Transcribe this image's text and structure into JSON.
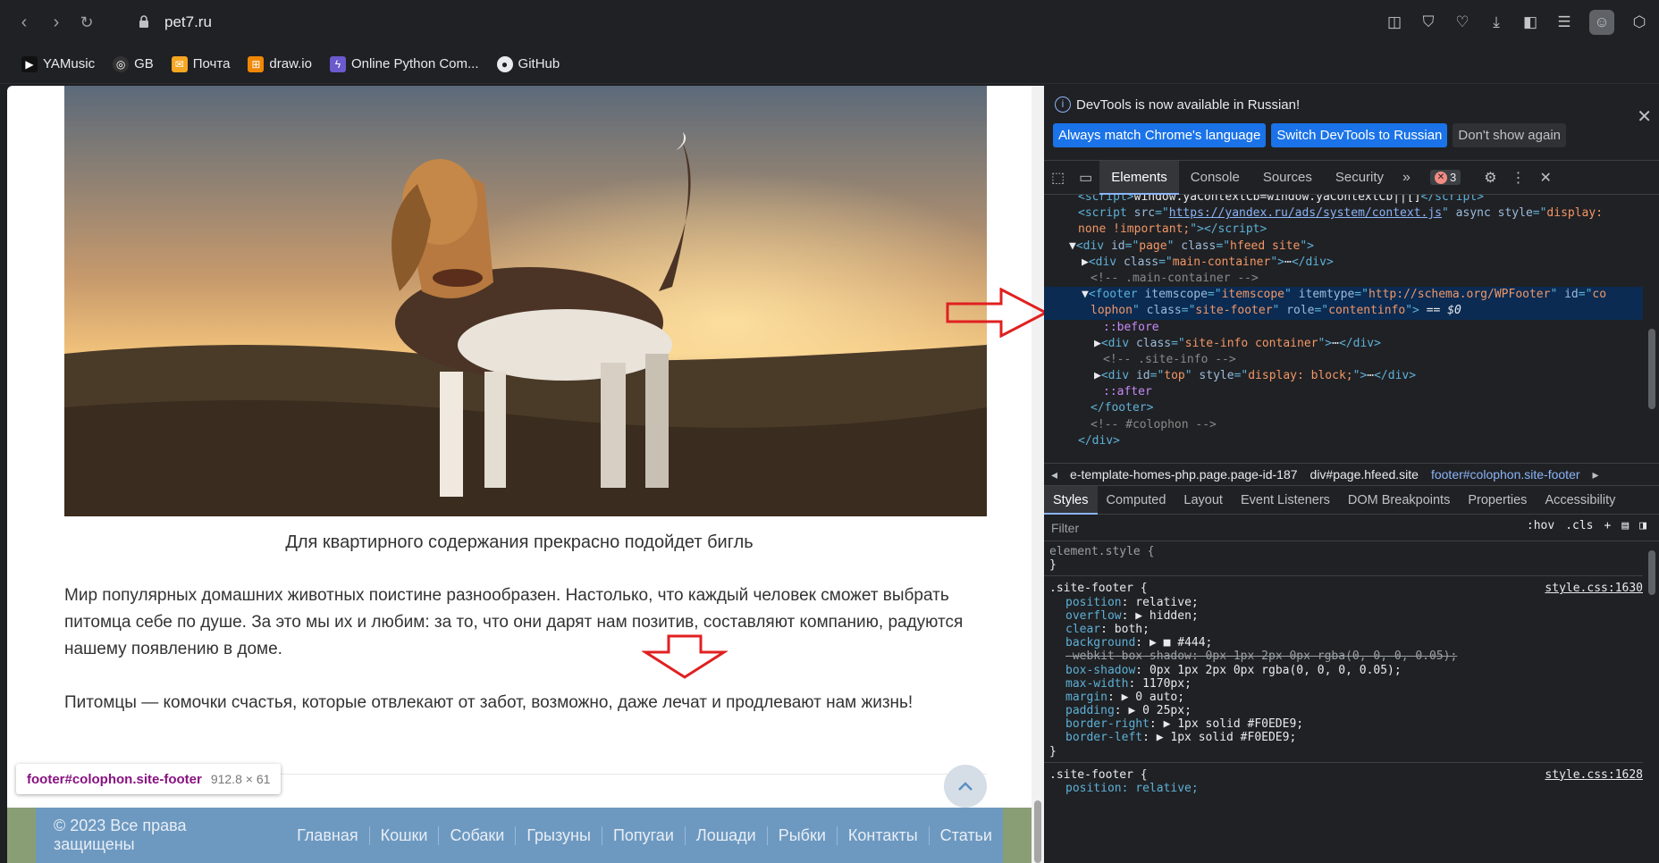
{
  "browser": {
    "url": "pet7.ru",
    "bookmarks": [
      {
        "label": "YAMusic",
        "color": "#ff3333"
      },
      {
        "label": "GB",
        "color": "#444444"
      },
      {
        "label": "Почта",
        "color": "#f5a623"
      },
      {
        "label": "draw.io",
        "color": "#f08705"
      },
      {
        "label": "Online Python Com...",
        "color": "#7b68ee"
      },
      {
        "label": "GitHub",
        "color": "#333333"
      }
    ]
  },
  "page": {
    "caption": "Для квартирного содержания прекрасно подойдет бигль",
    "paragraph1": "Мир популярных домашних животных поистине разнообразен. Настолько, что каждый человек сможет выбрать питомца себе по душе. За это мы их и любим: за то, что они дарят нам позитив, составляют компанию, радуются нашему появлению в доме.",
    "paragraph2": "Питомцы — комочки счастья, которые отвлекают от забот, возможно, даже лечат и продлевают нам жизнь!",
    "tooltip": {
      "tag": "footer#colophon.site-footer",
      "size": "912.8 × 61"
    },
    "footer": {
      "copyright": "© 2023 Все права защищены",
      "nav": [
        "Главная",
        "Кошки",
        "Собаки",
        "Грызуны",
        "Попугаи",
        "Лошади",
        "Рыбки",
        "Контакты",
        "Статьи"
      ]
    }
  },
  "devtools": {
    "info_message": "DevTools is now available in Russian!",
    "info_buttons": {
      "match": "Always match Chrome's language",
      "switch": "Switch DevTools to Russian",
      "dismiss": "Don't show again"
    },
    "tabs": [
      "Elements",
      "Console",
      "Sources",
      "Security"
    ],
    "error_count": "3",
    "breadcrumbs": [
      "e-template-homes-php.page.page-id-187",
      "div#page.hfeed.site",
      "footer#colophon.site-footer"
    ],
    "style_tabs": [
      "Styles",
      "Computed",
      "Layout",
      "Event Listeners",
      "DOM Breakpoints",
      "Properties",
      "Accessibility"
    ],
    "filter_placeholder": "Filter",
    "filter_tools": {
      "hov": ":hov",
      "cls": ".cls"
    },
    "element_style": "element.style {",
    "rule_selector": ".site-footer {",
    "rule_source": "style.css:1630",
    "rule2_selector": ".site-footer {",
    "rule2_source": "style.css:1628",
    "properties": [
      {
        "name": "position",
        "value": "relative;"
      },
      {
        "name": "overflow",
        "value": "▶ hidden;"
      },
      {
        "name": "clear",
        "value": "both;"
      },
      {
        "name": "background",
        "value": "▶ ■ #444;"
      },
      {
        "name": "-webkit-box-shadow",
        "value": "0px 1px 2px 0px rgba(0, 0, 0, 0.05);"
      },
      {
        "name": "box-shadow",
        "value": "0px 1px 2px 0px rgba(0, 0, 0, 0.05);"
      },
      {
        "name": "max-width",
        "value": "1170px;"
      },
      {
        "name": "margin",
        "value": "▶ 0 auto;"
      },
      {
        "name": "padding",
        "value": "▶ 0 25px;"
      },
      {
        "name": "border-right",
        "value": "▶ 1px solid #F0EDE9;"
      },
      {
        "name": "border-left",
        "value": "▶ 1px solid #F0EDE9;"
      }
    ],
    "rule2_first_prop": "position: relative;"
  }
}
